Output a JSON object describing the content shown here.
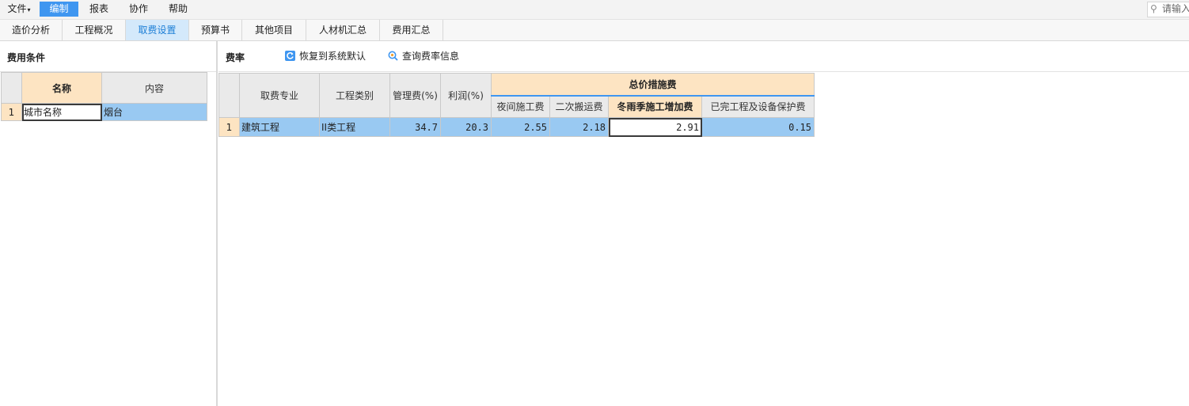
{
  "menu": {
    "file": "文件",
    "edit": "编制",
    "report": "报表",
    "collab": "协作",
    "help": "帮助",
    "search_placeholder": "请输入"
  },
  "tabs": [
    "造价分析",
    "工程概况",
    "取费设置",
    "预算书",
    "其他项目",
    "人材机汇总",
    "费用汇总"
  ],
  "active_tab": "取费设置",
  "left": {
    "title": "费用条件",
    "columns": [
      "名称",
      "内容"
    ],
    "rows": [
      {
        "no": "1",
        "name": "城市名称",
        "content": "烟台"
      }
    ]
  },
  "right": {
    "title": "费率",
    "restore_button": "恢复到系统默认",
    "query_button": "查询费率信息",
    "group_header": "总价措施费",
    "columns": {
      "specialty": "取费专业",
      "category": "工程类别",
      "management": "管理费(%)",
      "profit": "利润(%)",
      "night": "夜间施工费",
      "secondary": "二次搬运费",
      "winter": "冬雨季施工增加费",
      "protection": "已完工程及设备保护费"
    },
    "rows": [
      {
        "no": "1",
        "specialty": "建筑工程",
        "category": "II类工程",
        "management": "34.7",
        "profit": "20.3",
        "night": "2.55",
        "secondary": "2.18",
        "winter": "2.91",
        "protection": "0.15"
      }
    ]
  },
  "colors": {
    "accent": "#3f96f0",
    "header_highlight": "#fde4c2",
    "row_selected": "#99c9f2",
    "tab_active": "#d4e9fb"
  }
}
